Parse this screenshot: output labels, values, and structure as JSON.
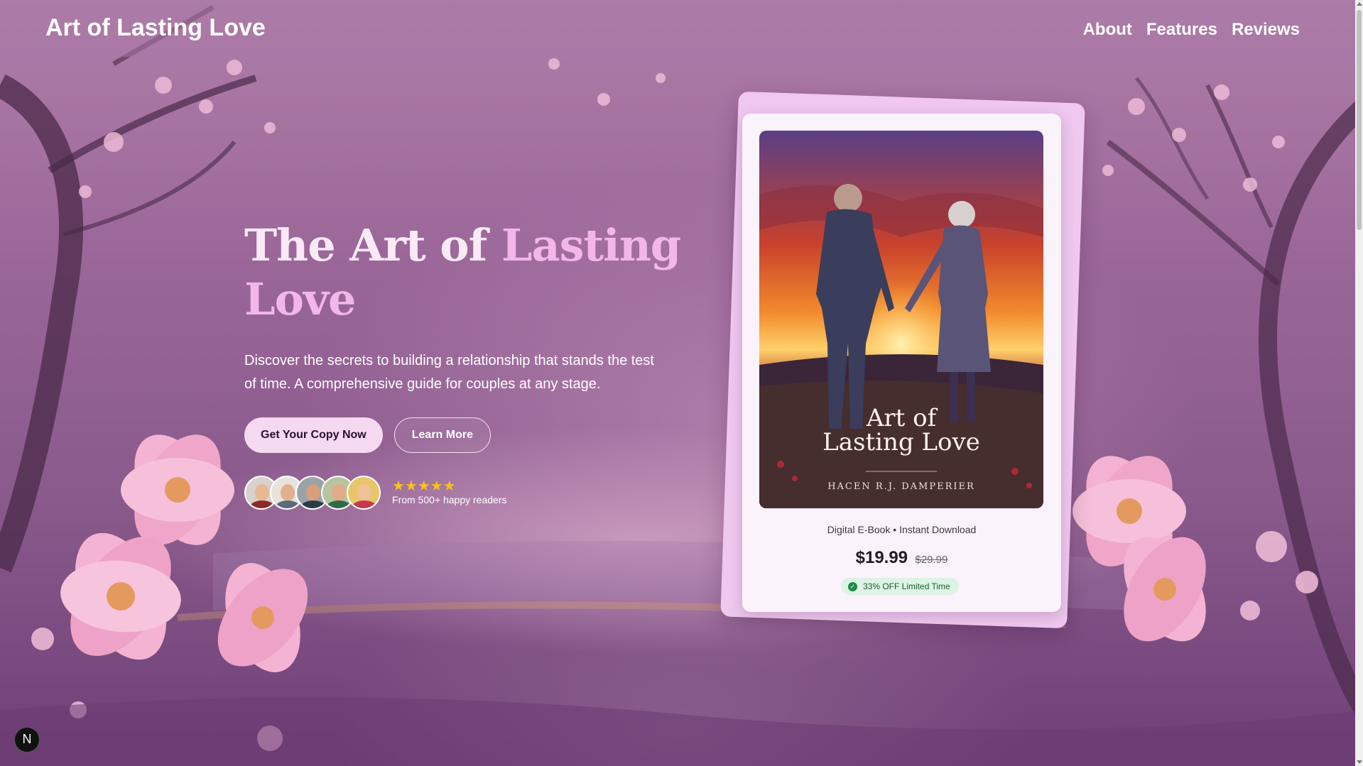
{
  "header": {
    "brand": "Art of Lasting Love",
    "nav": [
      "About",
      "Features",
      "Reviews"
    ]
  },
  "hero": {
    "title_main": "The Art of ",
    "title_accent_1": "Lasting",
    "title_accent_2": "Love",
    "description": "Discover the secrets to building a relationship that stands the test of time. A comprehensive guide for couples at any stage.",
    "primary_button": "Get Your Copy Now",
    "secondary_button": "Learn More",
    "stars": "★★★★★",
    "rating_text": "From 500+ happy readers"
  },
  "product": {
    "cover_title_line1": "Art of",
    "cover_title_line2": "Lasting Love",
    "cover_author": "HACEN R.J. DAMPERIER",
    "meta": "Digital E-Book • Instant Download",
    "price": "$19.99",
    "old_price": "$29.99",
    "badge": "33% OFF Limited Time"
  },
  "dev_badge": "N",
  "colors": {
    "accent": "#f2b7e7",
    "button_bg": "#f5d9f1",
    "badge_bg": "#ddf3e4",
    "badge_text": "#1d5c34",
    "star": "#f7c21a"
  },
  "icons": [
    "check-circle-icon",
    "star-icon",
    "next-logo-icon"
  ]
}
